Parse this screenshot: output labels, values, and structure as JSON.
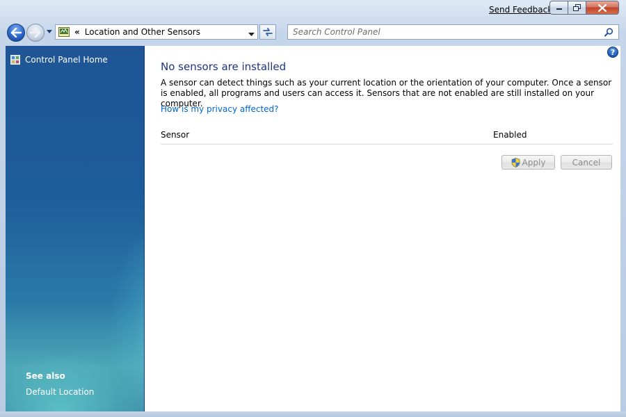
{
  "titlebar": {
    "feedback_label": "Send Feedback"
  },
  "address": {
    "separator": "«",
    "path": "Location and Other Sensors"
  },
  "search": {
    "placeholder": "Search Control Panel"
  },
  "sidebar": {
    "home_label": "Control Panel Home",
    "see_also_label": "See also",
    "links": [
      "Default Location"
    ]
  },
  "main": {
    "heading": "No sensors are installed",
    "description": "A sensor can detect things such as your current location or the orientation of your computer. Once a sensor is enabled, all programs and users can access it. Sensors that are not enabled are still installed on your computer.",
    "privacy_link": "How is my privacy affected?",
    "columns": [
      "Sensor",
      "Enabled"
    ],
    "apply_label": "Apply",
    "cancel_label": "Cancel",
    "help_glyph": "?"
  },
  "icons": {
    "back": "back-arrow-icon",
    "forward": "forward-arrow-icon",
    "search": "search-icon",
    "help": "help-icon",
    "shield": "uac-shield-icon"
  },
  "colors": {
    "heading": "#1e3287",
    "link": "#0066cc",
    "sidebar_top": "#1f5596",
    "sidebar_bottom": "#4ea7b7"
  }
}
